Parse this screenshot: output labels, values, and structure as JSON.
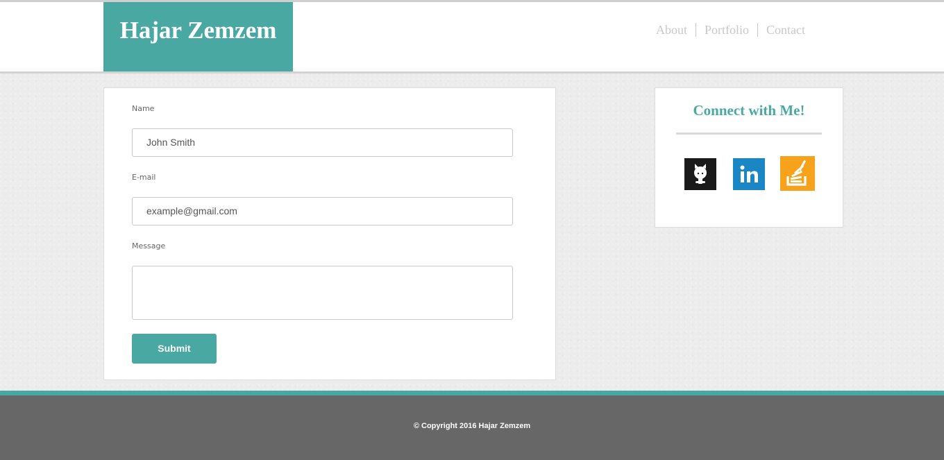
{
  "header": {
    "brand": "Hajar Zemzem",
    "nav": [
      {
        "label": "About"
      },
      {
        "label": "Portfolio"
      },
      {
        "label": "Contact"
      }
    ]
  },
  "form": {
    "name_label": "Name",
    "name_value": "John Smith",
    "email_label": "E-mail",
    "email_value": "example@gmail.com",
    "message_label": "Message",
    "message_value": "",
    "submit_label": "Submit"
  },
  "connect": {
    "title": "Connect with Me!",
    "links": [
      {
        "icon": "github-icon"
      },
      {
        "icon": "linkedin-icon"
      },
      {
        "icon": "stackoverflow-icon"
      }
    ]
  },
  "footer": {
    "copyright": "© Copyright 2016 Hajar Zemzem"
  },
  "colors": {
    "accent": "#4aa8a3",
    "footer_bg": "#676767",
    "linkedin": "#1b86c4",
    "stackoverflow": "#f6a21b",
    "github": "#1a1a1a"
  }
}
